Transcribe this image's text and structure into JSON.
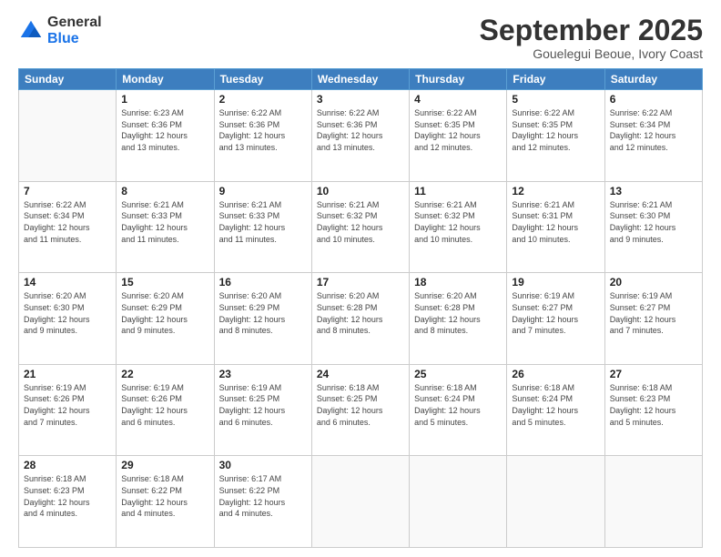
{
  "logo": {
    "general": "General",
    "blue": "Blue"
  },
  "header": {
    "month": "September 2025",
    "location": "Gouelegui Beoue, Ivory Coast"
  },
  "days_of_week": [
    "Sunday",
    "Monday",
    "Tuesday",
    "Wednesday",
    "Thursday",
    "Friday",
    "Saturday"
  ],
  "weeks": [
    [
      {
        "day": "",
        "info": ""
      },
      {
        "day": "1",
        "info": "Sunrise: 6:23 AM\nSunset: 6:36 PM\nDaylight: 12 hours\nand 13 minutes."
      },
      {
        "day": "2",
        "info": "Sunrise: 6:22 AM\nSunset: 6:36 PM\nDaylight: 12 hours\nand 13 minutes."
      },
      {
        "day": "3",
        "info": "Sunrise: 6:22 AM\nSunset: 6:36 PM\nDaylight: 12 hours\nand 13 minutes."
      },
      {
        "day": "4",
        "info": "Sunrise: 6:22 AM\nSunset: 6:35 PM\nDaylight: 12 hours\nand 12 minutes."
      },
      {
        "day": "5",
        "info": "Sunrise: 6:22 AM\nSunset: 6:35 PM\nDaylight: 12 hours\nand 12 minutes."
      },
      {
        "day": "6",
        "info": "Sunrise: 6:22 AM\nSunset: 6:34 PM\nDaylight: 12 hours\nand 12 minutes."
      }
    ],
    [
      {
        "day": "7",
        "info": "Sunrise: 6:22 AM\nSunset: 6:34 PM\nDaylight: 12 hours\nand 11 minutes."
      },
      {
        "day": "8",
        "info": "Sunrise: 6:21 AM\nSunset: 6:33 PM\nDaylight: 12 hours\nand 11 minutes."
      },
      {
        "day": "9",
        "info": "Sunrise: 6:21 AM\nSunset: 6:33 PM\nDaylight: 12 hours\nand 11 minutes."
      },
      {
        "day": "10",
        "info": "Sunrise: 6:21 AM\nSunset: 6:32 PM\nDaylight: 12 hours\nand 10 minutes."
      },
      {
        "day": "11",
        "info": "Sunrise: 6:21 AM\nSunset: 6:32 PM\nDaylight: 12 hours\nand 10 minutes."
      },
      {
        "day": "12",
        "info": "Sunrise: 6:21 AM\nSunset: 6:31 PM\nDaylight: 12 hours\nand 10 minutes."
      },
      {
        "day": "13",
        "info": "Sunrise: 6:21 AM\nSunset: 6:30 PM\nDaylight: 12 hours\nand 9 minutes."
      }
    ],
    [
      {
        "day": "14",
        "info": "Sunrise: 6:20 AM\nSunset: 6:30 PM\nDaylight: 12 hours\nand 9 minutes."
      },
      {
        "day": "15",
        "info": "Sunrise: 6:20 AM\nSunset: 6:29 PM\nDaylight: 12 hours\nand 9 minutes."
      },
      {
        "day": "16",
        "info": "Sunrise: 6:20 AM\nSunset: 6:29 PM\nDaylight: 12 hours\nand 8 minutes."
      },
      {
        "day": "17",
        "info": "Sunrise: 6:20 AM\nSunset: 6:28 PM\nDaylight: 12 hours\nand 8 minutes."
      },
      {
        "day": "18",
        "info": "Sunrise: 6:20 AM\nSunset: 6:28 PM\nDaylight: 12 hours\nand 8 minutes."
      },
      {
        "day": "19",
        "info": "Sunrise: 6:19 AM\nSunset: 6:27 PM\nDaylight: 12 hours\nand 7 minutes."
      },
      {
        "day": "20",
        "info": "Sunrise: 6:19 AM\nSunset: 6:27 PM\nDaylight: 12 hours\nand 7 minutes."
      }
    ],
    [
      {
        "day": "21",
        "info": "Sunrise: 6:19 AM\nSunset: 6:26 PM\nDaylight: 12 hours\nand 7 minutes."
      },
      {
        "day": "22",
        "info": "Sunrise: 6:19 AM\nSunset: 6:26 PM\nDaylight: 12 hours\nand 6 minutes."
      },
      {
        "day": "23",
        "info": "Sunrise: 6:19 AM\nSunset: 6:25 PM\nDaylight: 12 hours\nand 6 minutes."
      },
      {
        "day": "24",
        "info": "Sunrise: 6:18 AM\nSunset: 6:25 PM\nDaylight: 12 hours\nand 6 minutes."
      },
      {
        "day": "25",
        "info": "Sunrise: 6:18 AM\nSunset: 6:24 PM\nDaylight: 12 hours\nand 5 minutes."
      },
      {
        "day": "26",
        "info": "Sunrise: 6:18 AM\nSunset: 6:24 PM\nDaylight: 12 hours\nand 5 minutes."
      },
      {
        "day": "27",
        "info": "Sunrise: 6:18 AM\nSunset: 6:23 PM\nDaylight: 12 hours\nand 5 minutes."
      }
    ],
    [
      {
        "day": "28",
        "info": "Sunrise: 6:18 AM\nSunset: 6:23 PM\nDaylight: 12 hours\nand 4 minutes."
      },
      {
        "day": "29",
        "info": "Sunrise: 6:18 AM\nSunset: 6:22 PM\nDaylight: 12 hours\nand 4 minutes."
      },
      {
        "day": "30",
        "info": "Sunrise: 6:17 AM\nSunset: 6:22 PM\nDaylight: 12 hours\nand 4 minutes."
      },
      {
        "day": "",
        "info": ""
      },
      {
        "day": "",
        "info": ""
      },
      {
        "day": "",
        "info": ""
      },
      {
        "day": "",
        "info": ""
      }
    ]
  ]
}
